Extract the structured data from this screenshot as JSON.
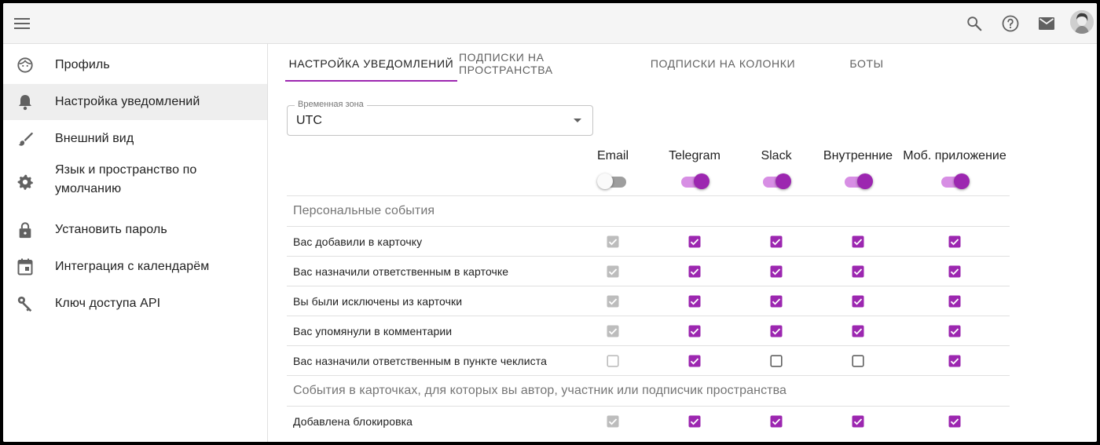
{
  "header": {
    "menu_icon": "hamburger-menu-icon",
    "search_icon": "search-icon",
    "help_icon": "help-icon",
    "mail_icon": "mail-icon",
    "avatar": "user-avatar"
  },
  "sidebar": {
    "items": [
      {
        "label": "Профиль",
        "icon": "face-icon",
        "active": false
      },
      {
        "label": "Настройка уведомлений",
        "icon": "bell-icon",
        "active": true
      },
      {
        "label": "Внешний вид",
        "icon": "brush-icon",
        "active": false
      },
      {
        "label": "Язык и пространство по",
        "label2": "умолчанию",
        "icon": "gear-icon",
        "active": false
      },
      {
        "label": "Установить пароль",
        "icon": "lock-icon",
        "active": false
      },
      {
        "label": "Интеграция с календарём",
        "icon": "calendar-icon",
        "active": false
      },
      {
        "label": "Ключ доступа API",
        "icon": "key-icon",
        "active": false
      }
    ]
  },
  "tabs": [
    {
      "label": "НАСТРОЙКА УВЕДОМЛЕНИЙ",
      "active": true
    },
    {
      "label": "ПОДПИСКИ НА ПРОСТРАНСТВА",
      "active": false
    },
    {
      "label": "ПОДПИСКИ НА КОЛОНКИ",
      "active": false
    },
    {
      "label": "БОТЫ",
      "active": false
    }
  ],
  "timezone": {
    "legend": "Временная зона",
    "value": "UTC"
  },
  "channels": [
    {
      "label": "Email",
      "enabled": false
    },
    {
      "label": "Telegram",
      "enabled": true
    },
    {
      "label": "Slack",
      "enabled": true
    },
    {
      "label": "Внутренние",
      "enabled": true
    },
    {
      "label": "Моб. приложение",
      "enabled": true
    }
  ],
  "sections": [
    {
      "title": "Персональные события",
      "events": [
        {
          "label": "Вас добавили в карточку",
          "checks": [
            "disabled-checked",
            "checked",
            "checked",
            "checked",
            "checked"
          ]
        },
        {
          "label": "Вас назначили ответственным в карточке",
          "checks": [
            "disabled-checked",
            "checked",
            "checked",
            "checked",
            "checked"
          ]
        },
        {
          "label": "Вы были исключены из карточки",
          "checks": [
            "disabled-checked",
            "checked",
            "checked",
            "checked",
            "checked"
          ]
        },
        {
          "label": "Вас упомянули в комментарии",
          "checks": [
            "disabled-checked",
            "checked",
            "checked",
            "checked",
            "checked"
          ]
        },
        {
          "label": "Вас назначили ответственным в пункте чеклиста",
          "checks": [
            "disabled-unchecked",
            "checked",
            "unchecked",
            "unchecked",
            "checked"
          ]
        }
      ]
    },
    {
      "title": "События в карточках, для которых вы автор, участник или подписчик пространства",
      "events": [
        {
          "label": "Добавлена блокировка",
          "checks": [
            "disabled-checked",
            "checked",
            "checked",
            "checked",
            "checked"
          ]
        }
      ]
    }
  ],
  "colors": {
    "accent": "#9c27b0",
    "accent_light": "#d78ee4",
    "disabled": "#bdbdbd"
  }
}
